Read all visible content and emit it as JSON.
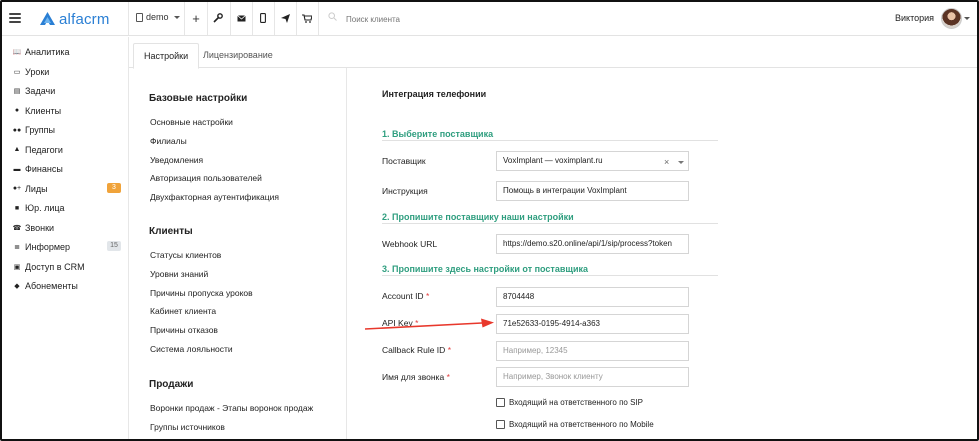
{
  "header": {
    "logo_text": "alfacrm",
    "branch": "demo",
    "search_placeholder": "Поиск клиента",
    "user_name": "Виктория"
  },
  "sidebar": {
    "items": [
      {
        "label": "Аналитика",
        "icon": "book-icon"
      },
      {
        "label": "Уроки",
        "icon": "calendar-icon"
      },
      {
        "label": "Задачи",
        "icon": "tasks-icon"
      },
      {
        "label": "Клиенты",
        "icon": "user-icon"
      },
      {
        "label": "Группы",
        "icon": "users-icon"
      },
      {
        "label": "Педагоги",
        "icon": "graduation-cap-icon"
      },
      {
        "label": "Финансы",
        "icon": "money-icon"
      },
      {
        "label": "Лиды",
        "icon": "user-plus-icon",
        "badge": "3"
      },
      {
        "label": "Юр. лица",
        "icon": "briefcase-icon"
      },
      {
        "label": "Звонки",
        "icon": "phone-icon"
      },
      {
        "label": "Информер",
        "icon": "list-icon",
        "badge": "15"
      },
      {
        "label": "Доступ в CRM",
        "icon": "lock-icon"
      },
      {
        "label": "Абонементы",
        "icon": "tag-icon"
      }
    ]
  },
  "tabs": [
    {
      "label": "Настройки",
      "active": true
    },
    {
      "label": "Лицензирование",
      "active": false
    }
  ],
  "menu": {
    "sections": [
      {
        "title": "Базовые настройки",
        "links": [
          "Основные настройки",
          "Филиалы",
          "Уведомления",
          "Авторизация пользователей",
          "Двухфакторная аутентификация"
        ]
      },
      {
        "title": "Клиенты",
        "links": [
          "Статусы клиентов",
          "Уровни знаний",
          "Причины пропуска уроков",
          "Кабинет клиента",
          "Причины отказов",
          "Система лояльности"
        ]
      },
      {
        "title": "Продажи",
        "links": [
          "Воронки продаж - Этапы воронок продаж",
          "Группы источников"
        ]
      }
    ]
  },
  "panel": {
    "title": "Интеграция телефонии",
    "step1": "1. Выберите поставщика",
    "step2": "2. Пропишите поставщику наши настройки",
    "step3": "3. Пропишите здесь настройки от поставщика",
    "fields": {
      "provider": {
        "label": "Поставщик",
        "value": "VoxImplant — voximplant.ru"
      },
      "instruction": {
        "label": "Инструкция",
        "value": "Помощь в интеграции VoxImplant"
      },
      "webhook": {
        "label": "Webhook URL",
        "value": "https://demo.s20.online/api/1/sip/process?token"
      },
      "account_id": {
        "label": "Account ID",
        "required": "*",
        "value": "8704448"
      },
      "api_key": {
        "label": "API Key",
        "required": "*",
        "value": "71e52633-0195-4914-a363"
      },
      "callback_rule": {
        "label": "Callback Rule ID",
        "required": "*",
        "placeholder": "Например, 12345"
      },
      "call_name": {
        "label": "Имя для звонка",
        "required": "*",
        "placeholder": "Например, Звонок клиенту"
      }
    },
    "checkboxes": [
      "Входящий на ответственного по SIP",
      "Входящий на ответственного по Mobile"
    ]
  },
  "colors": {
    "accent": "#2a7fd4",
    "step_green": "#2f9e7f",
    "badge_orange": "#f0a33a",
    "arrow_red": "#e8382c"
  }
}
